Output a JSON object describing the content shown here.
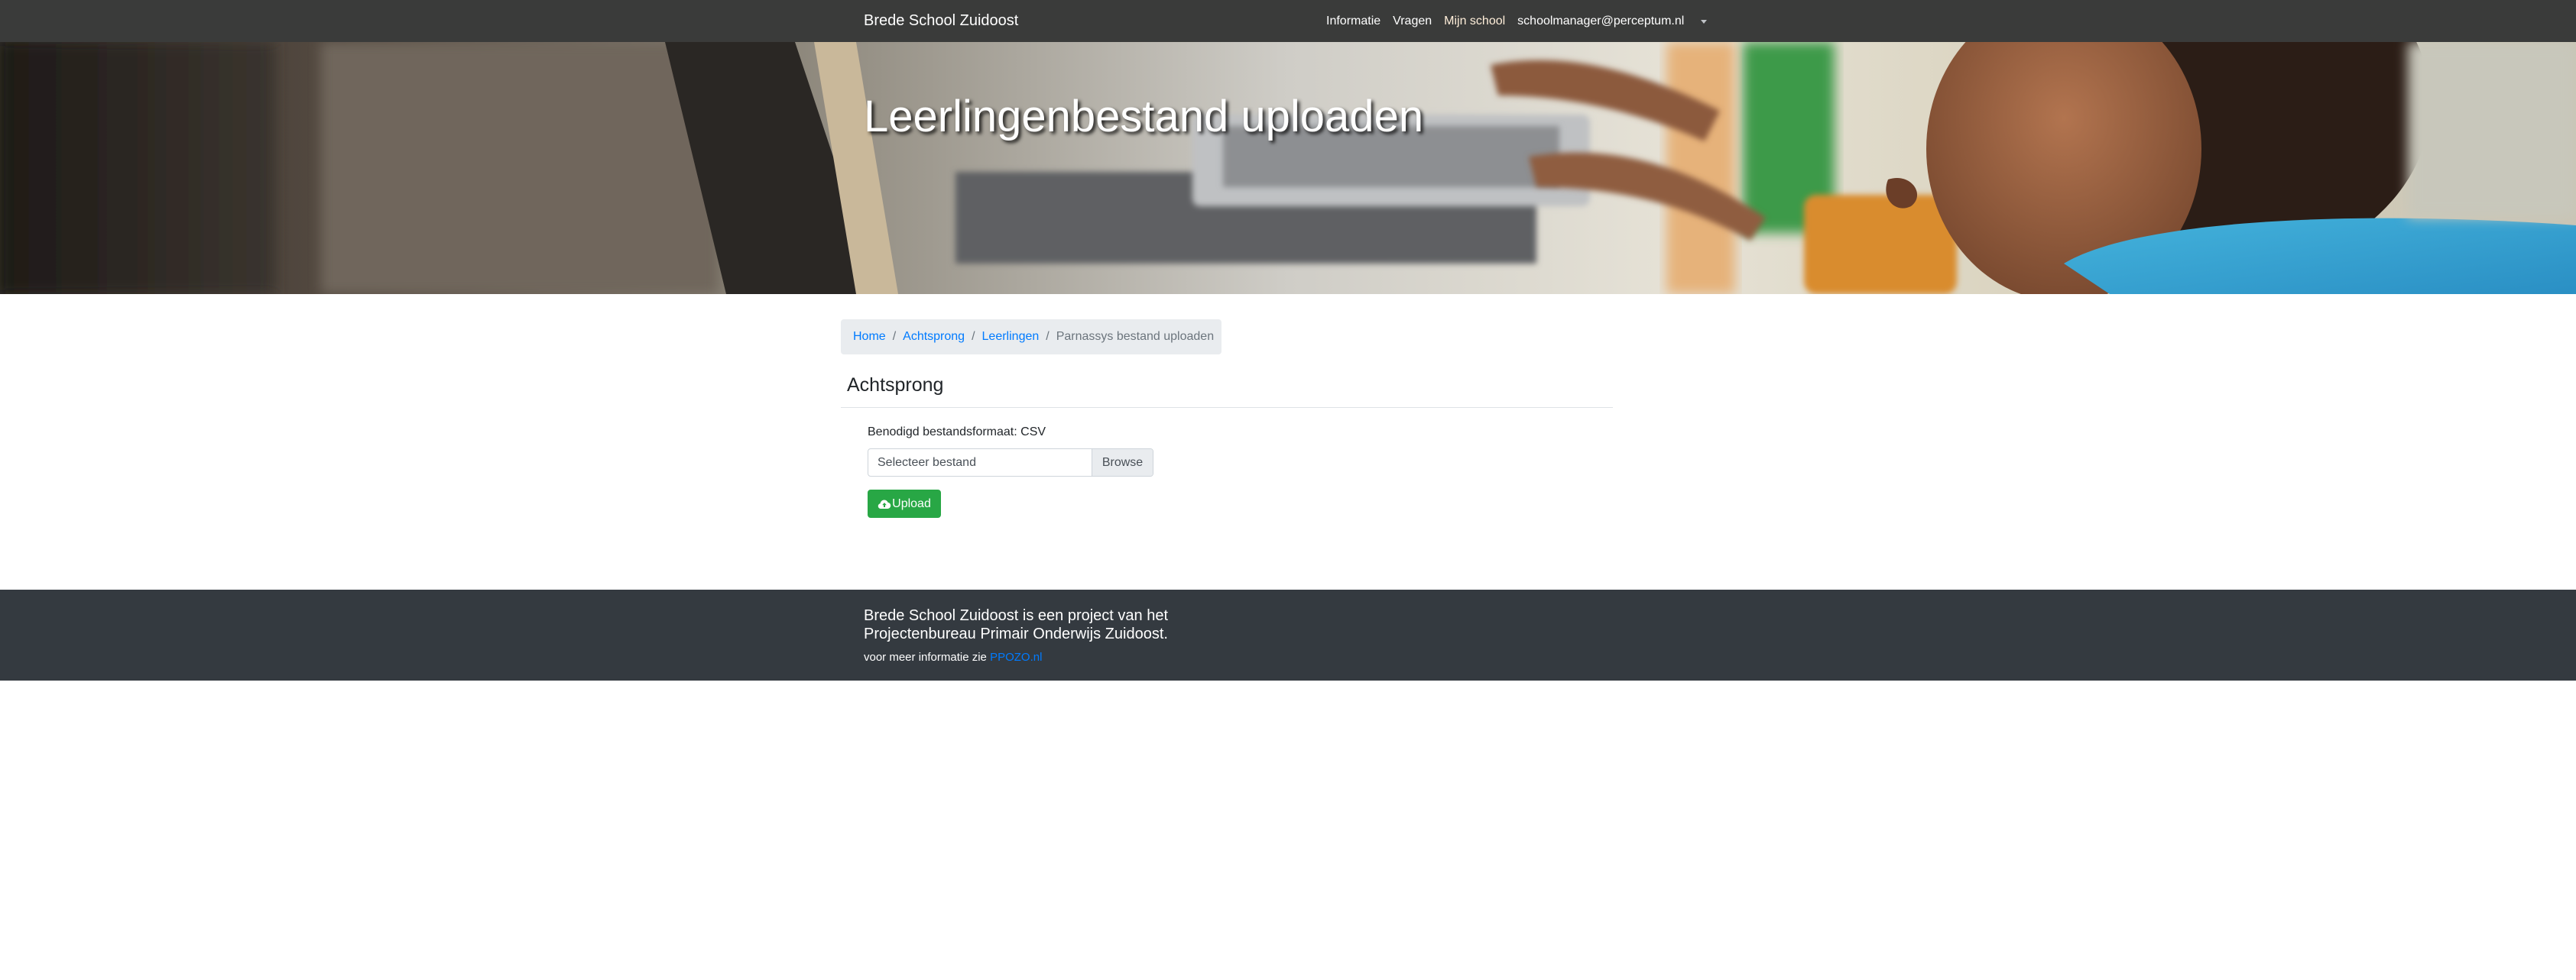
{
  "navbar": {
    "brand": "Brede School Zuidoost",
    "links": [
      {
        "label": "Informatie"
      },
      {
        "label": "Vragen"
      },
      {
        "label": "Mijn school"
      },
      {
        "label": "schoolmanager@perceptum.nl"
      }
    ],
    "active_link": "Mijn school",
    "caret_icon": "caret-down-icon"
  },
  "hero": {
    "title": "Leerlingenbestand uploaden"
  },
  "breadcrumb": {
    "items": [
      {
        "label": "Home"
      },
      {
        "label": "Achtsprong"
      },
      {
        "label": "Leerlingen"
      }
    ],
    "separator": "/",
    "current": "Parnassys bestand uploaden"
  },
  "main": {
    "title": "Achtsprong",
    "format_label": "Benodigd bestandsformaat: CSV",
    "file_input": {
      "placeholder": "Selecteer bestand",
      "browse_label": "Browse"
    },
    "upload": {
      "label": "Upload",
      "icon": "cloud-upload-icon"
    }
  },
  "footer": {
    "text": "Brede School Zuidoost is een project van het Projectenbureau Primair Onderwijs Zuidoost.",
    "info_prefix": "voor meer informatie zie",
    "link_label": "PPOZO.nl"
  },
  "colors": {
    "navbar_bg": "#3a3b3a",
    "link": "#007bff",
    "success": "#28a745",
    "footer_bg": "#343a40",
    "breadcrumb_bg": "#e9ecef"
  }
}
